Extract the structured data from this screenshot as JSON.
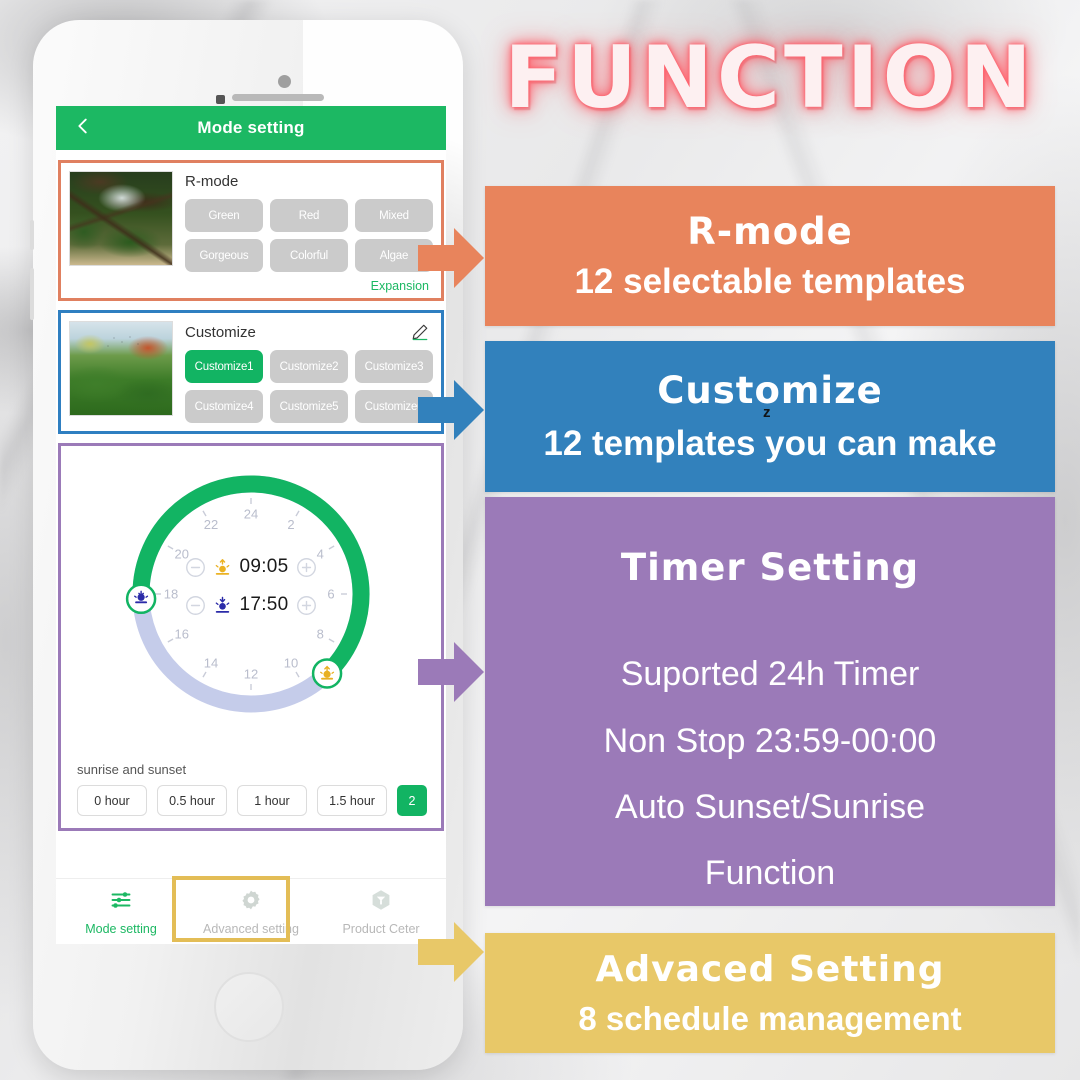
{
  "poster": {
    "title": "FUNCTION",
    "title_glow_color": "#ff5a66"
  },
  "phone": {
    "screen": {
      "navbar": {
        "back_icon": "chevron-left-icon",
        "title": "Mode setting"
      },
      "rmode_card": {
        "border_color": "#E08060",
        "thumbnail_alt": "aquascape-driftwood-thumbnail",
        "title": "R-mode",
        "chips": [
          {
            "label": "Green",
            "active": false
          },
          {
            "label": "Red",
            "active": false
          },
          {
            "label": "Mixed",
            "active": false
          },
          {
            "label": "Gorgeous",
            "active": false
          },
          {
            "label": "Colorful",
            "active": false
          },
          {
            "label": "Algae",
            "active": false
          }
        ],
        "expansion_link": "Expansion"
      },
      "customize_card": {
        "border_color": "#2F7FC1",
        "thumbnail_alt": "aquascape-moss-thumbnail",
        "title": "Customize",
        "edit_icon": "pencil-icon",
        "chips": [
          {
            "label": "Customize1",
            "active": true
          },
          {
            "label": "Customize2",
            "active": false
          },
          {
            "label": "Customize3",
            "active": false
          },
          {
            "label": "Customize4",
            "active": false
          },
          {
            "label": "Customize5",
            "active": false
          },
          {
            "label": "Customize6",
            "active": false
          }
        ]
      },
      "timer_card": {
        "border_color": "#9B7AB8",
        "dial": {
          "track_color": "#C5CCEA",
          "active_color": "#12B463",
          "hour_labels": [
            "24",
            "2",
            "4",
            "6",
            "8",
            "10",
            "12",
            "14",
            "16",
            "18",
            "20",
            "22"
          ],
          "sunrise_handle_hour": 9.083,
          "sunset_handle_hour": 17.833
        },
        "sunrise": {
          "icon": "sunrise-icon",
          "time": "09:05",
          "minus_icon": "minus-circle-icon",
          "plus_icon": "plus-circle-icon"
        },
        "sunset": {
          "icon": "sunset-icon",
          "time": "17:50",
          "minus_icon": "minus-circle-icon",
          "plus_icon": "plus-circle-icon"
        },
        "fade_label": "sunrise and sunset",
        "fade_options": [
          {
            "label": "0 hour",
            "selected": false
          },
          {
            "label": "0.5 hour",
            "selected": false
          },
          {
            "label": "1 hour",
            "selected": false
          },
          {
            "label": "1.5 hour",
            "selected": false
          },
          {
            "label": "2",
            "selected": true
          }
        ]
      },
      "tabbar": {
        "highlight_color": "#E3BD56",
        "tabs": [
          {
            "label": "Mode setting",
            "icon": "sliders-icon",
            "active": true
          },
          {
            "label": "Advanced setting",
            "icon": "gear-icon",
            "active": false
          },
          {
            "label": "Product Ceter",
            "icon": "hexagon-icon",
            "active": false
          }
        ]
      }
    }
  },
  "arrows": [
    {
      "name": "arrow-rmode",
      "color": "#E8845C"
    },
    {
      "name": "arrow-customize",
      "color": "#3281BC"
    },
    {
      "name": "arrow-timer",
      "color": "#9B7AB8"
    },
    {
      "name": "arrow-advanced",
      "color": "#E8C868"
    }
  ],
  "panels": {
    "rmode": {
      "heading": "R-mode",
      "line1": "12 selectable templates",
      "color": "#E8845C"
    },
    "customize": {
      "heading": "Customize",
      "line1": "12 templates you can make",
      "superscript": "z",
      "color": "#3281BC"
    },
    "timer": {
      "heading": "Timer  Setting",
      "line1": "Suported 24h Timer",
      "line2": "Non Stop 23:59-00:00",
      "line3": "Auto Sunset/Sunrise",
      "line4": "Function",
      "color": "#9B7AB8"
    },
    "advanced": {
      "heading": "Advaced  Setting",
      "line1": "8 schedule management",
      "color": "#E8C868"
    }
  }
}
